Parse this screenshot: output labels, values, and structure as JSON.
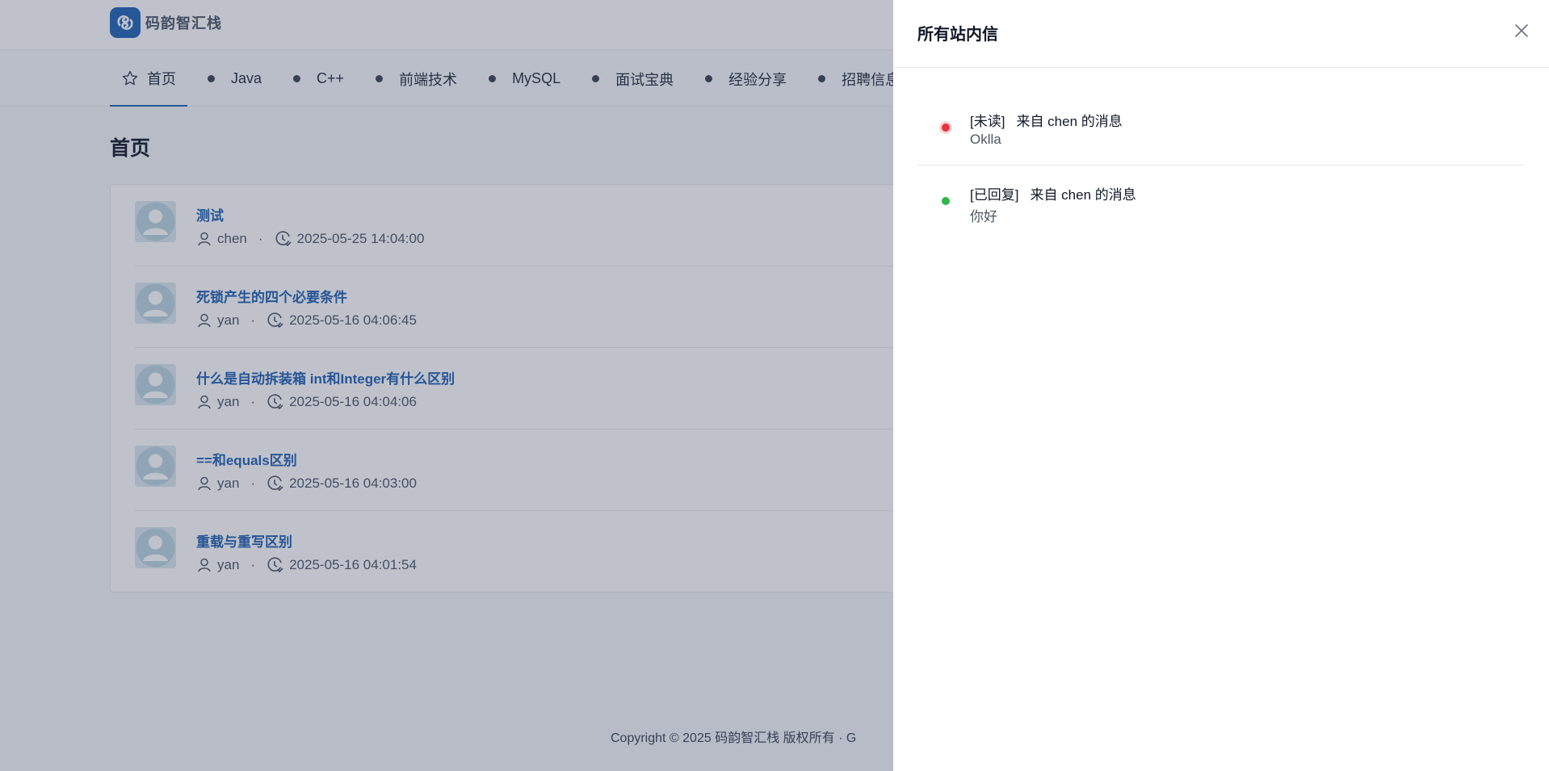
{
  "brand": {
    "name": "码韵智汇栈"
  },
  "nav": {
    "items": [
      {
        "label": "首页",
        "active": true,
        "icon": "star-icon"
      },
      {
        "label": "Java"
      },
      {
        "label": "C++"
      },
      {
        "label": "前端技术"
      },
      {
        "label": "MySQL"
      },
      {
        "label": "面试宝典"
      },
      {
        "label": "经验分享"
      },
      {
        "label": "招聘信息"
      }
    ]
  },
  "page": {
    "title": "首页"
  },
  "posts": [
    {
      "title": "测试",
      "author": "chen",
      "separator": "·",
      "time": "2025-05-25 14:04:00"
    },
    {
      "title": "死锁产生的四个必要条件",
      "author": "yan",
      "separator": "·",
      "time": "2025-05-16 04:06:45"
    },
    {
      "title": "什么是自动拆装箱 int和Integer有什么区别",
      "author": "yan",
      "separator": "·",
      "time": "2025-05-16 04:04:06"
    },
    {
      "title": "==和equals区别",
      "author": "yan",
      "separator": "·",
      "time": "2025-05-16 04:03:00"
    },
    {
      "title": "重载与重写区别",
      "author": "yan",
      "separator": "·",
      "time": "2025-05-16 04:01:54"
    }
  ],
  "footer": {
    "text": "Copyright © 2025 码韵智汇栈 版权所有 · G"
  },
  "drawer": {
    "title": "所有站内信",
    "messages": [
      {
        "status": "[未读]",
        "status_color": "#e5343f",
        "from": "来自 chen 的消息",
        "content": "Oklla"
      },
      {
        "status": "[已回复]",
        "status_color": "#2fb64b",
        "from": "来自 chen 的消息",
        "content": "你好"
      }
    ]
  },
  "colors": {
    "brand": "#1e63b4",
    "link": "#1e5fb0",
    "unread": "#e5343f",
    "replied": "#2fb64b"
  }
}
